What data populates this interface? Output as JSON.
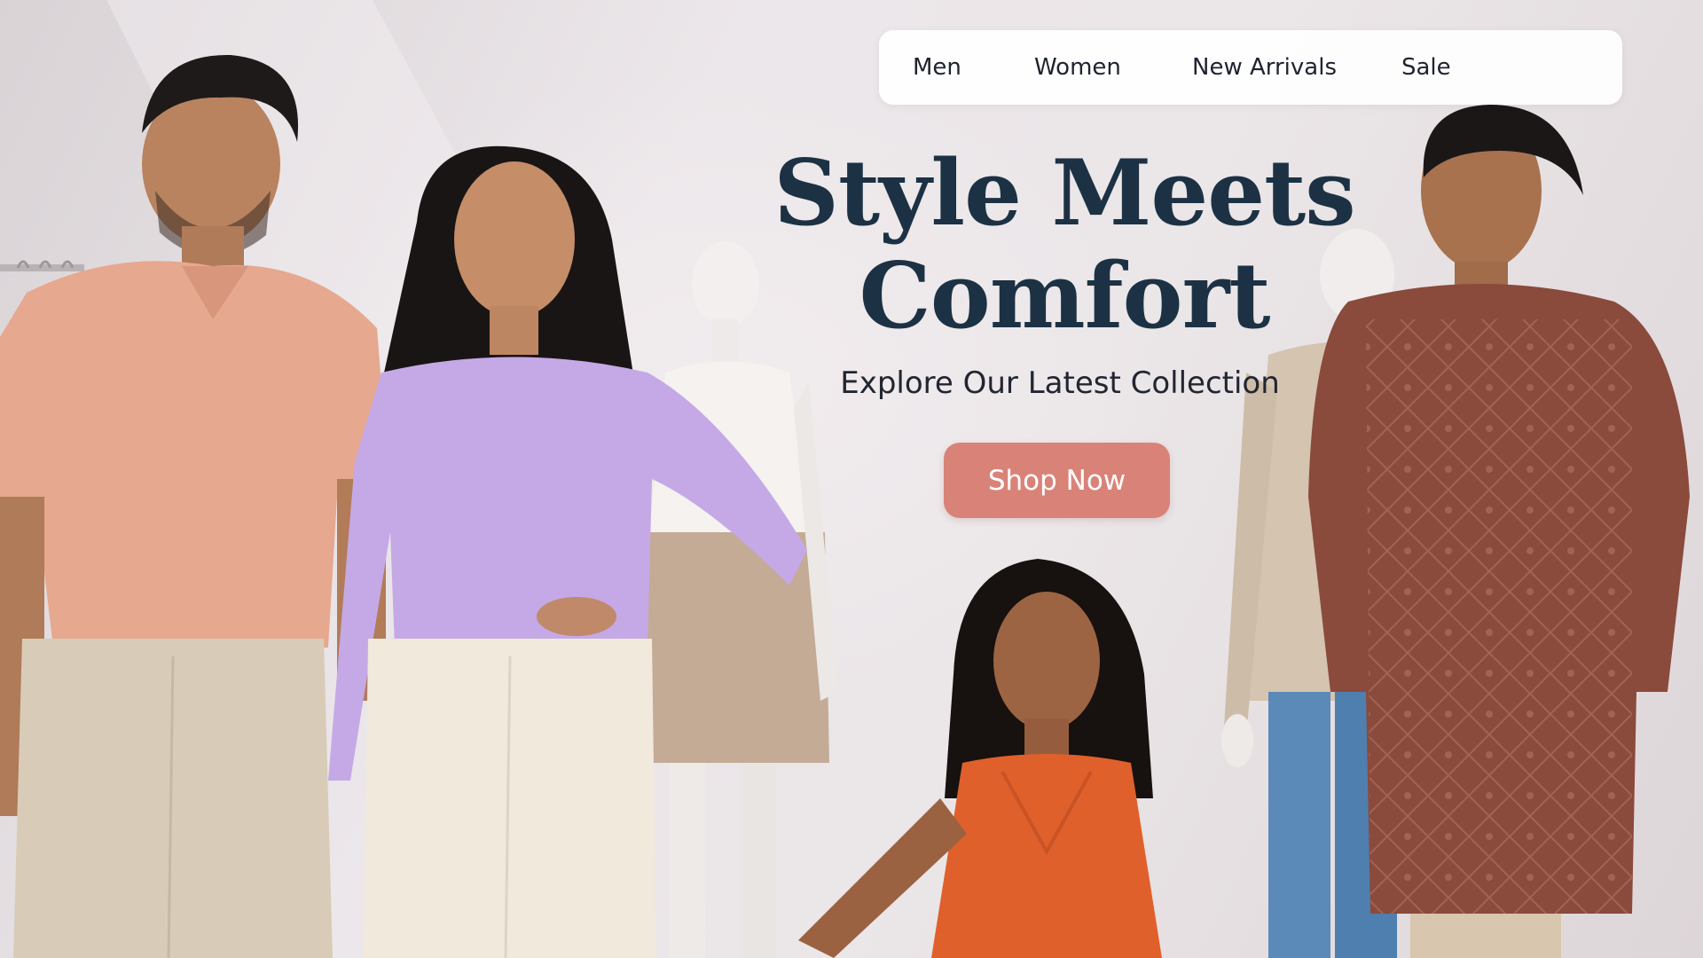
{
  "nav": {
    "items": [
      {
        "label": "Men"
      },
      {
        "label": "Women"
      },
      {
        "label": "New Arrivals"
      },
      {
        "label": "Sale"
      }
    ]
  },
  "hero": {
    "title_line1": "Style Meets",
    "title_line2": "Comfort",
    "subtitle": "Explore Our Latest Collection",
    "cta_label": "Shop Now"
  },
  "colors": {
    "cta_background": "#d98378",
    "title_text": "#1c3244",
    "nav_background": "#ffffff"
  },
  "images": {
    "hero_background": "fashion-models-photo"
  }
}
